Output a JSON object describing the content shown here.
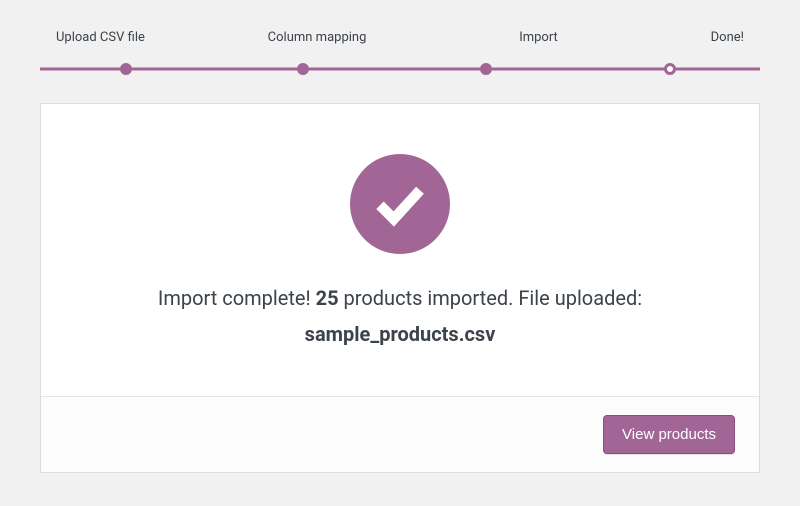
{
  "stepper": {
    "steps": [
      {
        "label": "Upload CSV file",
        "state": "done"
      },
      {
        "label": "Column mapping",
        "state": "done"
      },
      {
        "label": "Import",
        "state": "done"
      },
      {
        "label": "Done!",
        "state": "active"
      }
    ]
  },
  "result": {
    "message_prefix": "Import complete! ",
    "count": "25",
    "message_mid": " products imported. File uploaded:",
    "filename": "sample_products.csv"
  },
  "accent_color": "#a16696",
  "actions": {
    "view_products_label": "View products"
  }
}
